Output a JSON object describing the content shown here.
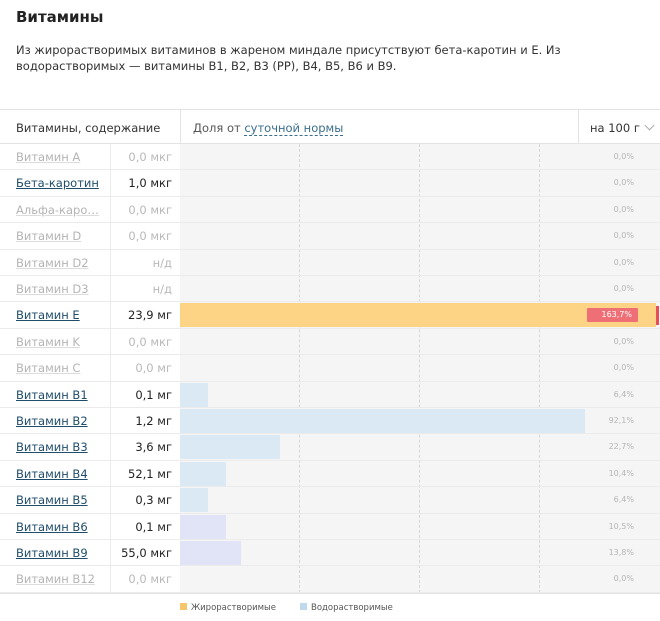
{
  "header": {
    "title": "Витамины",
    "description": "Из жирорастворимых витаминов в жареном миндале присутствуют бета-каротин и E. Из водорастворимых — витамины B1, B2, B3 (PP), B4, B5, B6 и B9."
  },
  "table": {
    "col1_label": "Витамины, содержание",
    "col2_prefix": "Доля от",
    "col2_link": "суточной нормы",
    "unit_selector": "на 100 г"
  },
  "colors": {
    "fat": "#fdd485",
    "water": "#dbe9f4",
    "water_alt": "#e1e4f7",
    "highlight": "#ef6f76"
  },
  "rows": [
    {
      "name": "Витамин A",
      "value": "0,0 мкг",
      "pct_label": "0,0%",
      "pct": 0,
      "active": false,
      "kind": "fat"
    },
    {
      "name": "Бета-каротин",
      "value": "1,0 мкг",
      "pct_label": "0,0%",
      "pct": 0,
      "active": true,
      "kind": "fat"
    },
    {
      "name": "Альфа-каро…",
      "value": "0,0 мкг",
      "pct_label": "0,0%",
      "pct": 0,
      "active": false,
      "kind": "fat"
    },
    {
      "name": "Витамин D",
      "value": "0,0 мкг",
      "pct_label": "0,0%",
      "pct": 0,
      "active": false,
      "kind": "fat"
    },
    {
      "name": "Витамин D2",
      "value": "н/д",
      "pct_label": "0,0%",
      "pct": 0,
      "active": false,
      "kind": "fat"
    },
    {
      "name": "Витамин D3",
      "value": "н/д",
      "pct_label": "0,0%",
      "pct": 0,
      "active": false,
      "kind": "fat"
    },
    {
      "name": "Витамин E",
      "value": "23,9 мг",
      "pct_label": "163,7%",
      "pct": 163.7,
      "active": true,
      "kind": "fat",
      "highlight": true
    },
    {
      "name": "Витамин K",
      "value": "0,0 мкг",
      "pct_label": "0,0%",
      "pct": 0,
      "active": false,
      "kind": "fat"
    },
    {
      "name": "Витамин C",
      "value": "0,0 мг",
      "pct_label": "0,0%",
      "pct": 0,
      "active": false,
      "kind": "water"
    },
    {
      "name": "Витамин B1",
      "value": "0,1 мг",
      "pct_label": "6,4%",
      "pct": 6.4,
      "active": true,
      "kind": "water"
    },
    {
      "name": "Витамин B2",
      "value": "1,2 мг",
      "pct_label": "92,1%",
      "pct": 92.1,
      "active": true,
      "kind": "water"
    },
    {
      "name": "Витамин B3",
      "value": "3,6 мг",
      "pct_label": "22,7%",
      "pct": 22.7,
      "active": true,
      "kind": "water"
    },
    {
      "name": "Витамин B4",
      "value": "52,1 мг",
      "pct_label": "10,4%",
      "pct": 10.4,
      "active": true,
      "kind": "water"
    },
    {
      "name": "Витамин B5",
      "value": "0,3 мг",
      "pct_label": "6,4%",
      "pct": 6.4,
      "active": true,
      "kind": "water"
    },
    {
      "name": "Витамин B6",
      "value": "0,1 мг",
      "pct_label": "10,5%",
      "pct": 10.5,
      "active": true,
      "kind": "water_alt"
    },
    {
      "name": "Витамин B9",
      "value": "55,0 мкг",
      "pct_label": "13,8%",
      "pct": 13.8,
      "active": true,
      "kind": "water_alt"
    },
    {
      "name": "Витамин B12",
      "value": "0,0 мкг",
      "pct_label": "0,0%",
      "pct": 0,
      "active": false,
      "kind": "water"
    }
  ],
  "legend": {
    "fat_label": "Жирорастворимые",
    "water_label": "Водорастворимые"
  }
}
